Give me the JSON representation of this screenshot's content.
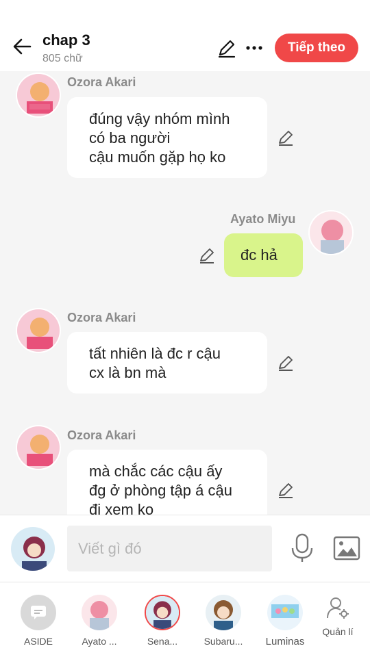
{
  "header": {
    "title": "chap 3",
    "subtitle": "805 chữ",
    "next_label": "Tiếp theo",
    "accent": "#f04848"
  },
  "messages": [
    {
      "sender": "Ozora Akari",
      "side": "left",
      "lines": [
        "đúng vậy nhóm mình",
        "có ba người",
        "cậu muốn gặp họ ko"
      ]
    },
    {
      "sender": "Ayato  Miyu",
      "side": "right",
      "lines": [
        "đc hả"
      ]
    },
    {
      "sender": "Ozora Akari",
      "side": "left",
      "lines": [
        "tất nhiên là đc r cậu",
        "cx là bn mà"
      ]
    },
    {
      "sender": "Ozora Akari",
      "side": "left",
      "lines": [
        "mà chắc các cậu ấy",
        "đg ở phòng tập á cậu",
        "đi xem ko"
      ]
    }
  ],
  "input": {
    "placeholder": "Viết gì đó"
  },
  "characters": [
    {
      "label": "ASIDE",
      "icon": "aside-icon"
    },
    {
      "label": "Ayato ...",
      "icon": "avatar"
    },
    {
      "label": "Sena...",
      "icon": "avatar"
    },
    {
      "label": "Subaru...",
      "icon": "avatar"
    },
    {
      "label": "Luminas",
      "icon": "avatar"
    },
    {
      "label": "Quản lí",
      "icon": "manage-user-icon"
    }
  ],
  "colors": {
    "bubble_me": "#d9f48b",
    "bubble_other": "#ffffff",
    "chat_bg": "#f5f5f5"
  }
}
